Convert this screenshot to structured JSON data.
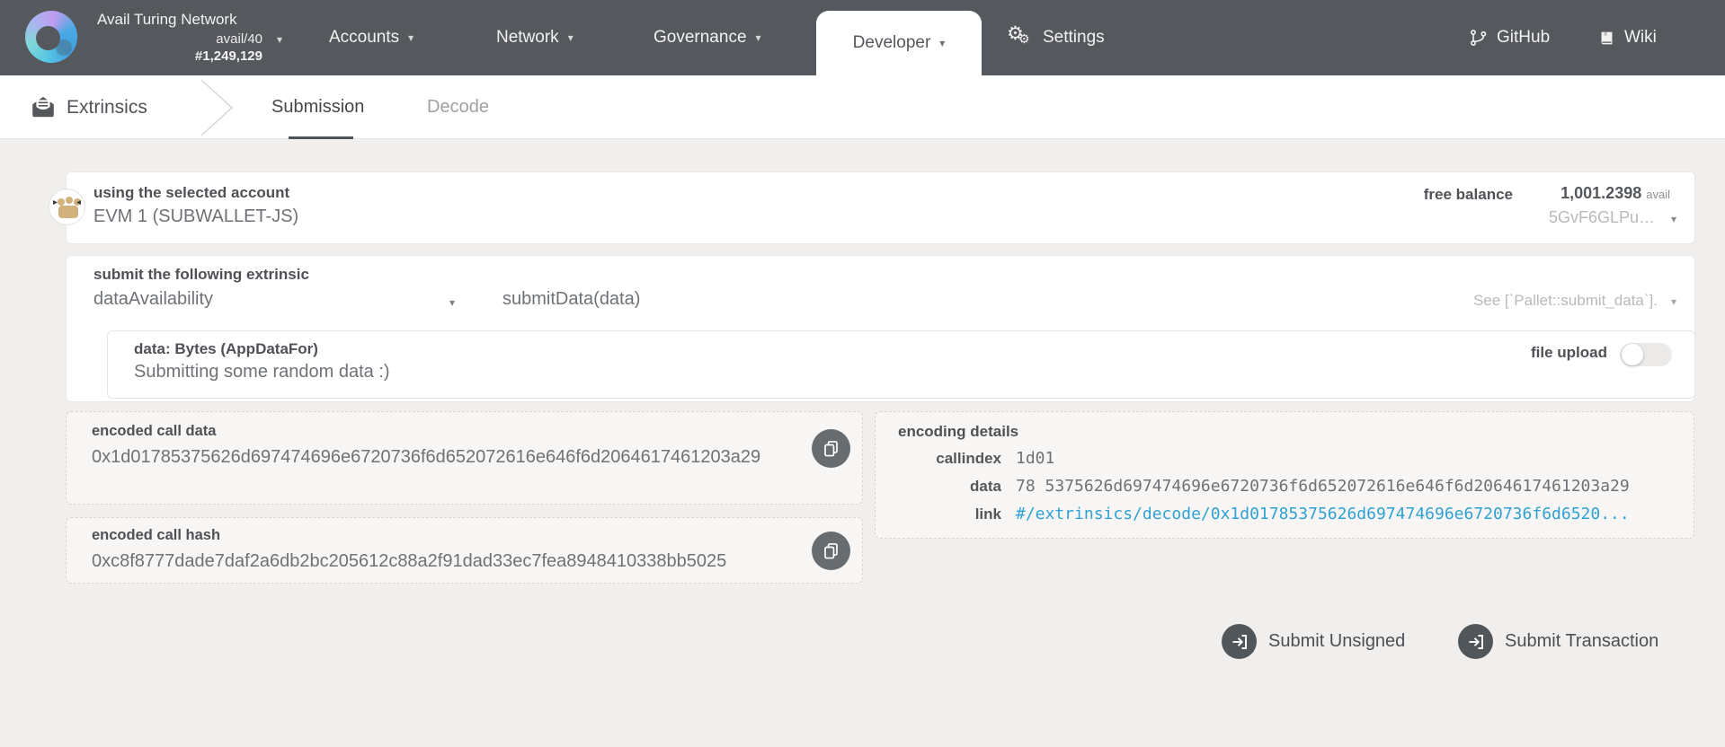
{
  "brand": {
    "network_name": "Avail Turing Network",
    "runtime_version": "avail/40",
    "block_number": "#1,249,129"
  },
  "nav": {
    "accounts": "Accounts",
    "network": "Network",
    "governance": "Governance",
    "developer": "Developer",
    "settings": "Settings"
  },
  "links": {
    "github": "GitHub",
    "wiki": "Wiki"
  },
  "tabbar": {
    "section": "Extrinsics",
    "submission": "Submission",
    "decode": "Decode"
  },
  "account": {
    "selected_label": "using the selected account",
    "name": "EVM 1 (SUBWALLET-JS)",
    "free_balance_label": "free balance",
    "free_balance_value": "1,001.2398",
    "free_balance_unit": "avail",
    "address": "5GvF6GLPu…"
  },
  "extrinsic": {
    "section_label": "submit the following extrinsic",
    "pallet": "dataAvailability",
    "method": "submitData(data)",
    "doc": "See [`Pallet::submit_data`]."
  },
  "data_param": {
    "label": "data: Bytes (AppDataFor)",
    "value": "Submitting some random data :)",
    "file_upload_label": "file upload",
    "file_upload_state": "off"
  },
  "call_data": {
    "label": "encoded call data",
    "value": "0x1d01785375626d697474696e6720736f6d652072616e646f6d2064617461203a29"
  },
  "call_hash": {
    "label": "encoded call hash",
    "value": "0xc8f8777dade7daf2a6db2bc205612c88a2f91dad33ec7fea8948410338bb5025"
  },
  "encoding": {
    "label": "encoding details",
    "callindex_label": "callindex",
    "callindex_value": "1d01",
    "data_label": "data",
    "data_value": "78 5375626d697474696e6720736f6d652072616e646f6d2064617461203a29",
    "link_label": "link",
    "link_value": "#/extrinsics/decode/0x1d01785375626d697474696e6720736f6d6520..."
  },
  "actions": {
    "submit_unsigned": "Submit Unsigned",
    "submit_transaction": "Submit Transaction"
  },
  "icons": {
    "caret": "▾",
    "gear": "⚙"
  },
  "colors": {
    "header_bg": "#55595d",
    "link_accent": "#2ea1d4",
    "page_bg": "#f1efed",
    "copy_button_bg": "#676c70"
  }
}
